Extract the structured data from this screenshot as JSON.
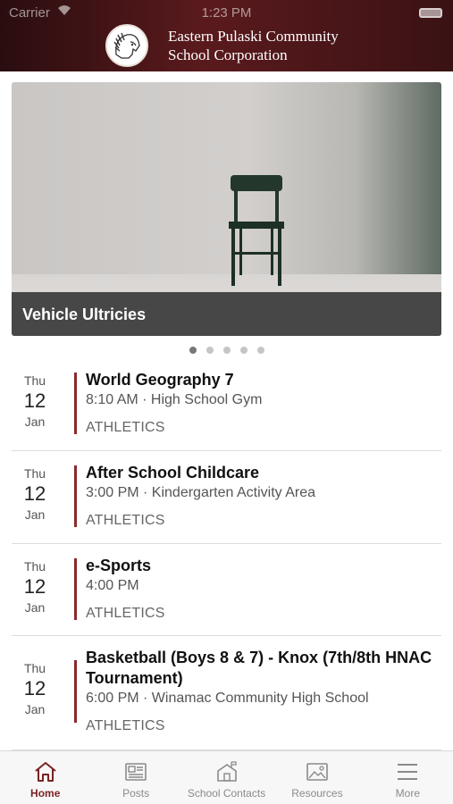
{
  "status_bar": {
    "carrier": "Carrier",
    "time": "1:23 PM"
  },
  "header": {
    "logo_icon": "indian-head-logo-icon",
    "org_line1": "Eastern Pulaski Community",
    "org_line2": "School Corporation",
    "gradient": "#5a1a1d"
  },
  "carousel": {
    "caption": "Vehicle Ultricies",
    "page_count": 5,
    "active_page": 1
  },
  "events": [
    {
      "dow": "Thu",
      "day": "12",
      "mon": "Jan",
      "title": "World Geography 7",
      "meta": "8:10 AM · High School Gym",
      "category": "ATHLETICS"
    },
    {
      "dow": "Thu",
      "day": "12",
      "mon": "Jan",
      "title": "After School Childcare",
      "meta": "3:00 PM · Kindergarten Activity Area",
      "category": "ATHLETICS"
    },
    {
      "dow": "Thu",
      "day": "12",
      "mon": "Jan",
      "title": "e-Sports",
      "meta": "4:00 PM",
      "category": "ATHLETICS"
    },
    {
      "dow": "Thu",
      "day": "12",
      "mon": "Jan",
      "title": "Basketball (Boys 8 & 7) - Knox (7th/8th HNAC Tournament)",
      "meta": "6:00 PM · Winamac Community High School",
      "category": "ATHLETICS"
    }
  ],
  "tabs": [
    {
      "label": "Home",
      "icon": "home-icon",
      "active": true
    },
    {
      "label": "Posts",
      "icon": "newspaper-icon",
      "active": false
    },
    {
      "label": "School Contacts",
      "icon": "school-building-icon",
      "active": false
    },
    {
      "label": "Resources",
      "icon": "image-icon",
      "active": false
    },
    {
      "label": "More",
      "icon": "hamburger-menu-icon",
      "active": false
    }
  ],
  "colors": {
    "accent": "#7a2325",
    "event_bar": "#8a2a2c",
    "caption_bg": "#474747"
  }
}
